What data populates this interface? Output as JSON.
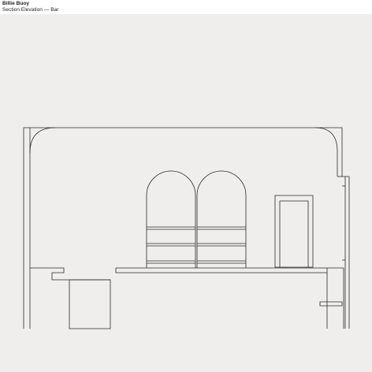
{
  "header": {
    "title": "Billie Buoy",
    "subtitle": "Section Elevation — Bar"
  },
  "colors": {
    "page_background": "#efeeec",
    "header_background": "#ffffff",
    "line": "#2a2a2a"
  }
}
